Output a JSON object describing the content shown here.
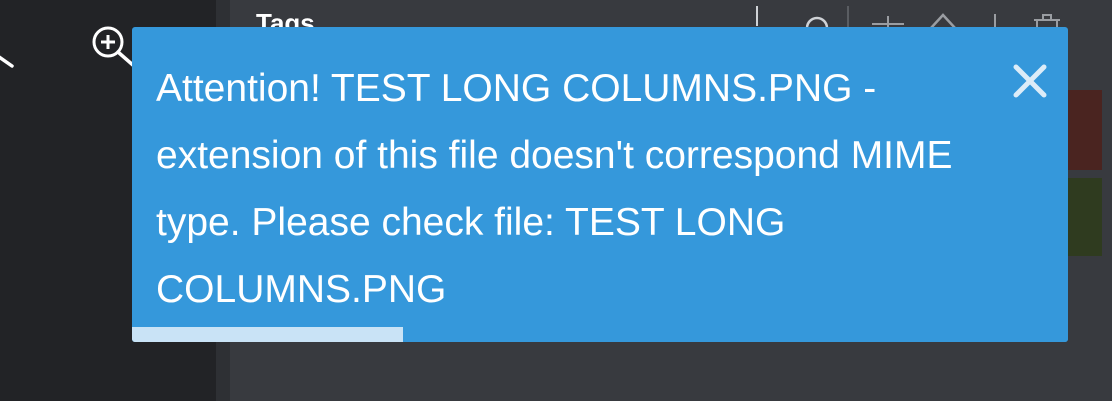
{
  "panel": {
    "title": "Tags"
  },
  "toolbar_icons": [
    "zoom-out-icon",
    "zoom-in-icon",
    "search-icon",
    "tag-icon",
    "upload-icon",
    "trash-icon"
  ],
  "notification": {
    "message": "Attention! TEST LONG COLUMNS.PNG - extension of this file doesn't correspond MIME type. Please check file: TEST LONG COLUMNS.PNG",
    "close_icon": "close-icon",
    "progress_fraction": 0.29,
    "color": "#3598db",
    "progress_color": "#c9e3f6"
  },
  "colors": {
    "tag_red": "#4a2420",
    "tag_green": "#2f3b1f"
  }
}
